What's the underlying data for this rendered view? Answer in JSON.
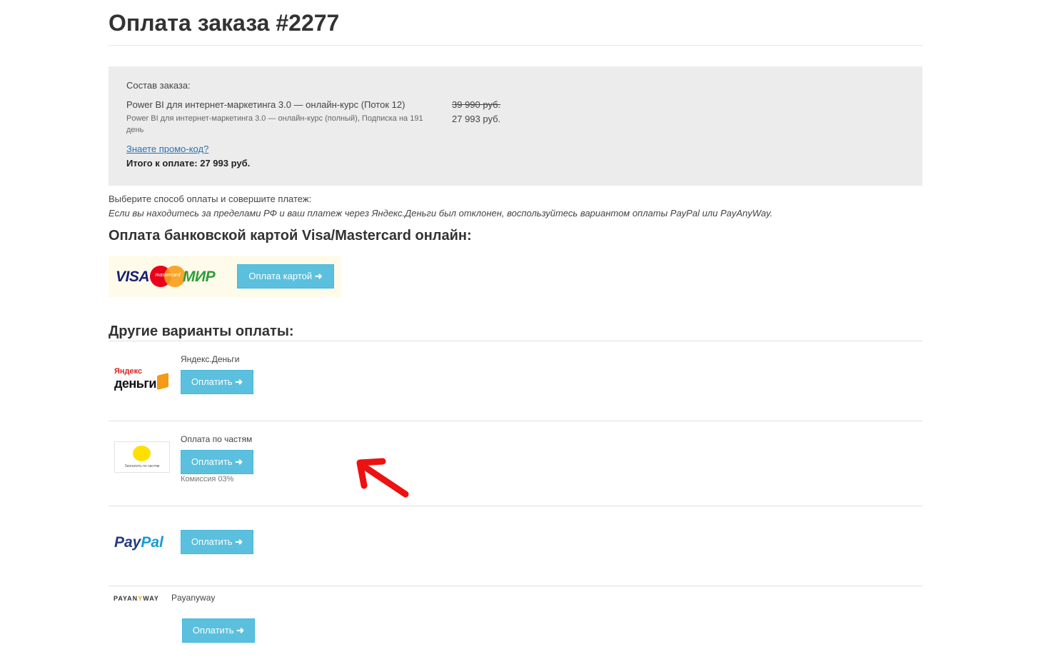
{
  "page": {
    "title": "Оплата заказа #2277"
  },
  "order": {
    "composition_label": "Состав заказа:",
    "item_name": "Power BI для интернет-маркетинга 3.0 — онлайн-курс (Поток 12)",
    "item_subtitle": "Power BI для интернет-маркетинга 3.0 — онлайн-курс (полный), Подписка на 191 день",
    "old_price": "39 990 руб.",
    "new_price": "27 993 руб.",
    "promo_link": "Знаете промо-код?",
    "total": "Итого к оплате: 27 993 руб."
  },
  "instructions": {
    "line1": "Выберите способ оплаты и совершите платеж:",
    "line2": "Если вы находитесь за пределами РФ и ваш платеж через Яндекс.Деньги был отклонен, воспользуйтесь вариантом оплаты PayPal или PayAnyWay."
  },
  "card_payment": {
    "heading": "Оплата банковской картой Visa/Mastercard онлайн:",
    "button": "Оплата картой",
    "logos": {
      "visa": "VISA",
      "mastercard": "mastercard",
      "mir": "МИР"
    }
  },
  "other_payments": {
    "heading": "Другие варианты оплаты:",
    "arrow_icon": "arrow-right-icon",
    "methods": [
      {
        "name": "Яндекс.Деньги",
        "button": "Оплатить",
        "logo_line1": "Яндекс",
        "logo_line2": "деньги"
      },
      {
        "name": "Оплата по частям",
        "button": "Оплатить",
        "commission": "Комиссия 03%",
        "logo_text": "Заплатить по частям"
      },
      {
        "name": "",
        "button": "Оплатить",
        "logo_part1": "Pay",
        "logo_part2": "Pal"
      },
      {
        "name": "Payanyway",
        "button": "Оплатить",
        "logo_part1": "PAYAN",
        "logo_part2": "Y",
        "logo_part3": "WAY"
      }
    ]
  },
  "annotation": {
    "arrow_color": "#ee1111"
  }
}
